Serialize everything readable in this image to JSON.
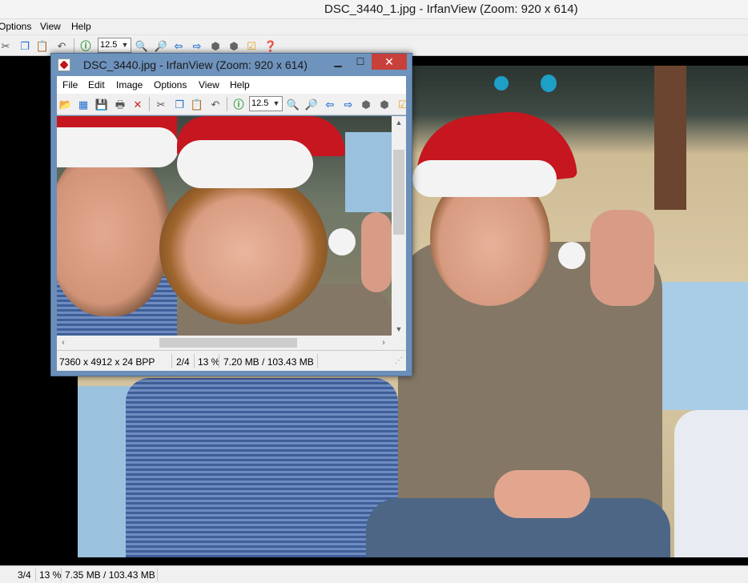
{
  "main_window": {
    "title": "DSC_3440_1.jpg - IrfanView (Zoom: 920 x 614)",
    "menu": [
      "Options",
      "View",
      "Help"
    ],
    "zoom_value": "12.5",
    "status": {
      "index": "3/4",
      "zoom_percent": "13 %",
      "memory": "7.35 MB / 103.43 MB"
    }
  },
  "small_window": {
    "title": "DSC_3440.jpg - IrfanView (Zoom: 920 x 614)",
    "menu": [
      "File",
      "Edit",
      "Image",
      "Options",
      "View",
      "Help"
    ],
    "zoom_value": "12.5",
    "status": {
      "dimensions": "7360 x 4912 x 24 BPP",
      "index": "2/4",
      "zoom_percent": "13 %",
      "memory": "7.20 MB / 103.43 MB"
    }
  },
  "icons": {
    "open": "folder-icon",
    "slideshow": "filmstrip-icon",
    "save": "floppy-icon",
    "print": "printer-icon",
    "delete": "red-x-icon",
    "cut": "scissors-icon",
    "copy": "copy-icon",
    "paste": "paste-icon",
    "undo": "undo-icon",
    "info": "info-icon",
    "zoom_in": "zoom-in-icon",
    "zoom_out": "zoom-out-icon",
    "prev": "arrow-left-icon",
    "next": "arrow-right-icon",
    "first": "shield-left-icon",
    "last": "shield-right-icon",
    "settings": "checklist-icon",
    "help": "help-icon"
  },
  "colors": {
    "title_active": "#6e93bd",
    "close_button": "#c7403a",
    "icon_blue": "#1e6fd1",
    "icon_green": "#2a9a3a"
  }
}
